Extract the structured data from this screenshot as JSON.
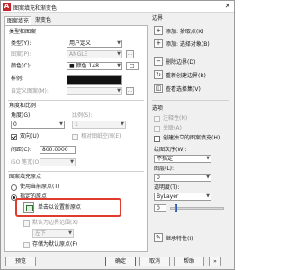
{
  "window": {
    "title": "图案填充和渐变色",
    "app_icon": "A",
    "close": "✕"
  },
  "tabs": [
    "图案填充",
    "渐变色"
  ],
  "type_pattern": {
    "section_title": "类型和图案",
    "type_label": "类型(Y):",
    "type_value": "用户定义",
    "pattern_label": "图案(P):",
    "pattern_value": "ANGLE",
    "color_label": "颜色(C):",
    "color_value": "■ 颜色 148",
    "bg_value": "□",
    "sample_label": "样例:",
    "custom_label": "自定义图案(M):"
  },
  "angle_scale": {
    "section_title": "角度和比例",
    "angle_label": "角度(G):",
    "angle_value": "0",
    "scale_label": "比例(S):",
    "scale_value": "1",
    "double_label": "双向(U)",
    "relative_label": "相对图纸空间(E)",
    "spacing_label": "间距(C):",
    "spacing_value": "800.0000",
    "iso_label": "ISO 笔宽(O):"
  },
  "origin": {
    "section_title": "图案填充原点",
    "current_label": "使用当前原点(T)",
    "specified_label": "指定的原点",
    "pick_button_label": "单击以设置新原点",
    "default_boundary_label": "默认为边界范围(X)",
    "default_boundary_value": "左下",
    "store_label": "存储为默认原点(F)"
  },
  "boundaries": {
    "section_title": "边界",
    "add_pick": "添加: 拾取点(K)",
    "add_select": "添加: 选择对象(B)",
    "remove": "删除边界(D)",
    "recreate": "重新创建边界(R)",
    "view_selection": "查看选择集(V)"
  },
  "options": {
    "section_title": "选项",
    "annotative": "注释性(N)",
    "associative": "关联(A)",
    "separate": "创建独立的图案填充(H)",
    "draw_order_label": "绘图次序(W):",
    "draw_order_value": "不指定",
    "layer_label": "图层(L):",
    "layer_value": "0",
    "transparency_label": "透明度(T):",
    "transparency_value": "ByLayer",
    "transparency_amount": "0",
    "transparency_fraction": 0.08
  },
  "inherit": {
    "label": "继承特性(I)"
  },
  "footer": {
    "preview": "预览",
    "ok": "确定",
    "cancel": "取消",
    "help": "帮助"
  },
  "colors": {
    "accent": "#e03b2e",
    "icon_red": "#c4262e"
  }
}
